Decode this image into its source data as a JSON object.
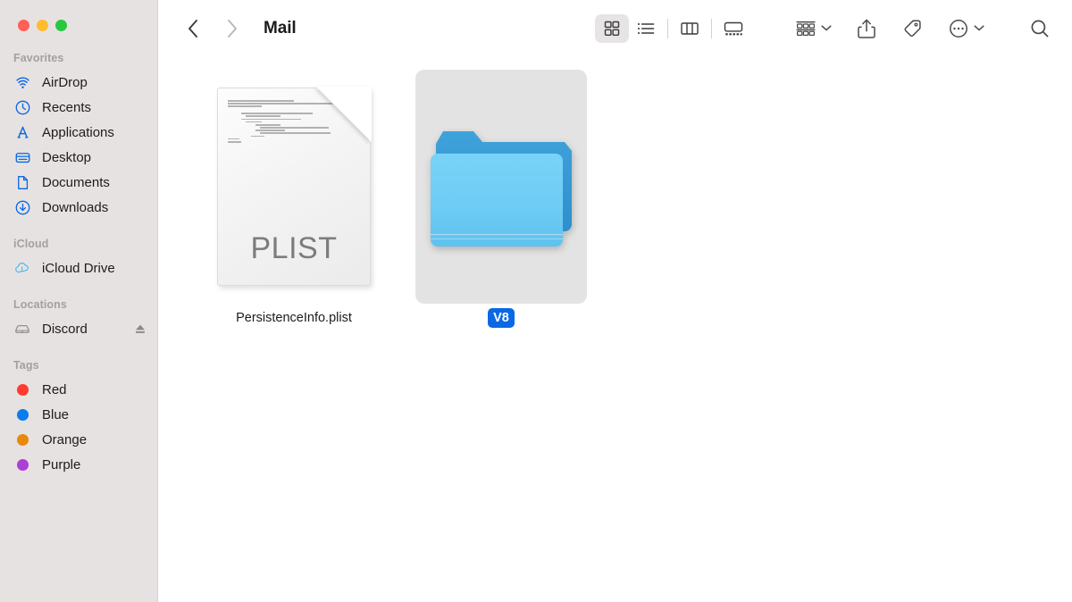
{
  "window": {
    "title": "Mail",
    "traffic_lights": [
      {
        "name": "close",
        "color": "#FF5F57"
      },
      {
        "name": "minimize",
        "color": "#FEBC2E"
      },
      {
        "name": "maximize",
        "color": "#28C840"
      }
    ]
  },
  "sidebar": {
    "sections": [
      {
        "header": "Favorites",
        "items": [
          {
            "label": "AirDrop",
            "icon": "airdrop-icon",
            "color": "#0A68E4"
          },
          {
            "label": "Recents",
            "icon": "clock-icon",
            "color": "#0A68E4"
          },
          {
            "label": "Applications",
            "icon": "applications-icon",
            "color": "#0A68E4"
          },
          {
            "label": "Desktop",
            "icon": "desktop-icon",
            "color": "#0A68E4"
          },
          {
            "label": "Documents",
            "icon": "document-icon",
            "color": "#0A68E4"
          },
          {
            "label": "Downloads",
            "icon": "downloads-icon",
            "color": "#0A68E4"
          }
        ]
      },
      {
        "header": "iCloud",
        "items": [
          {
            "label": "iCloud Drive",
            "icon": "icloud-drive-icon",
            "color": "#49B8E8"
          }
        ]
      },
      {
        "header": "Locations",
        "items": [
          {
            "label": "Discord",
            "icon": "external-drive-icon",
            "color": "#8A8A8A",
            "eject": "eject-icon"
          }
        ]
      },
      {
        "header": "Tags",
        "items": [
          {
            "label": "Red",
            "icon": "tag-dot-icon",
            "color": "#FF3B30"
          },
          {
            "label": "Blue",
            "icon": "tag-dot-icon",
            "color": "#0A7CF0"
          },
          {
            "label": "Orange",
            "icon": "tag-dot-icon",
            "color": "#E8890C"
          },
          {
            "label": "Purple",
            "icon": "tag-dot-icon",
            "color": "#AC3FD6"
          }
        ]
      }
    ]
  },
  "toolbar": {
    "back": {
      "name": "back-button",
      "enabled": true
    },
    "forward": {
      "name": "forward-button",
      "enabled": false
    },
    "views": [
      {
        "name": "icon-view",
        "label": "Icon view",
        "active": true
      },
      {
        "name": "list-view",
        "label": "List view",
        "active": false
      },
      {
        "name": "column-view",
        "label": "Column view",
        "active": false
      },
      {
        "name": "gallery-view",
        "label": "Gallery view",
        "active": false
      }
    ],
    "actions": [
      {
        "name": "group-by-button",
        "label": "Group",
        "has_chevron": true
      },
      {
        "name": "share-button",
        "label": "Share",
        "has_chevron": false
      },
      {
        "name": "tag-button",
        "label": "Tags",
        "has_chevron": false
      },
      {
        "name": "more-actions-button",
        "label": "More",
        "has_chevron": true
      }
    ],
    "search": {
      "name": "search-button",
      "label": "Search"
    }
  },
  "content": {
    "items": [
      {
        "name": "PersistenceInfo.plist",
        "type": "file",
        "icon": "plist-file-icon",
        "extension_label": "PLIST",
        "selected": false
      },
      {
        "name": "V8",
        "type": "folder",
        "icon": "folder-icon",
        "selected": true
      }
    ]
  }
}
